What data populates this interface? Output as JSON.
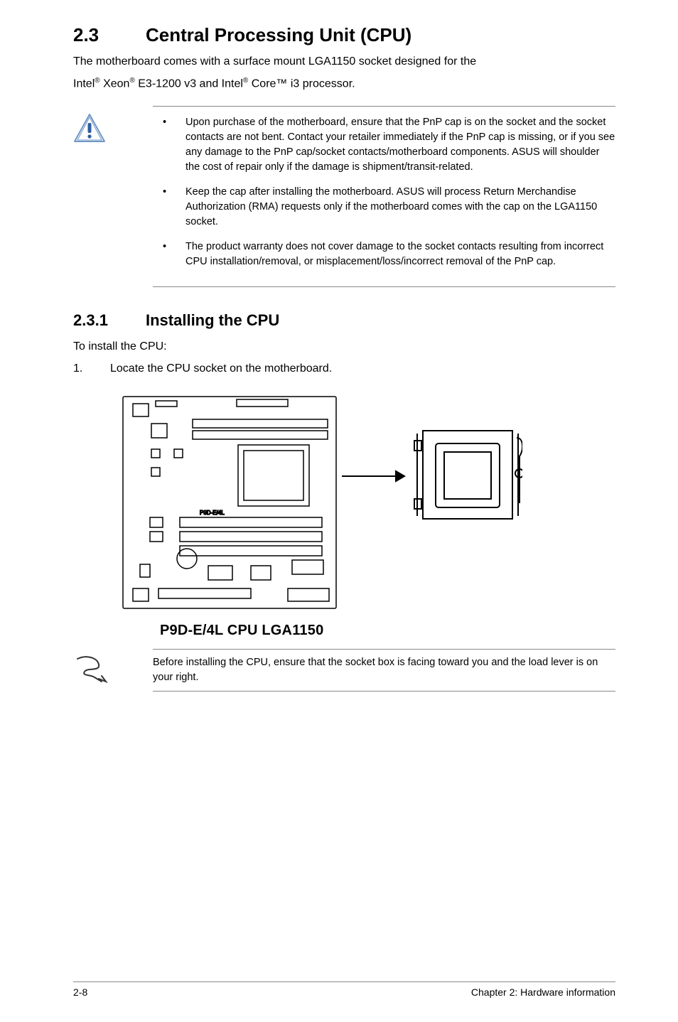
{
  "section": {
    "number": "2.3",
    "title": "Central Processing Unit (CPU)"
  },
  "intro_lines": {
    "l1": "The motherboard comes with a surface mount LGA1150 socket designed for the",
    "l2a": "Intel",
    "l2b": " Xeon",
    "l2c": " E3-1200 v3 and Intel",
    "l2d": " Core™ i3 processor."
  },
  "warnings": [
    "Upon purchase of the motherboard, ensure that the PnP cap is on the socket and the socket contacts are not bent. Contact your retailer immediately if the PnP cap is missing, or if you see any damage to the PnP cap/socket contacts/motherboard components. ASUS will shoulder the cost of repair only if the damage is shipment/transit-related.",
    "Keep the cap after installing the motherboard. ASUS will process Return Merchandise Authorization (RMA) requests only if the motherboard comes with the cap on the LGA1150 socket.",
    "The product warranty does not cover damage to the socket contacts resulting from incorrect CPU installation/removal, or misplacement/loss/incorrect removal of the PnP cap."
  ],
  "subsection": {
    "number": "2.3.1",
    "title": "Installing the CPU"
  },
  "install_intro": "To install the CPU:",
  "steps": [
    "Locate the CPU socket on the motherboard."
  ],
  "diagram_caption": "P9D-E/4L CPU LGA1150",
  "note": "Before installing the CPU, ensure that the socket box is facing toward you and the load lever is on your right.",
  "footer": {
    "page": "2-8",
    "chapter": "Chapter 2: Hardware information"
  }
}
